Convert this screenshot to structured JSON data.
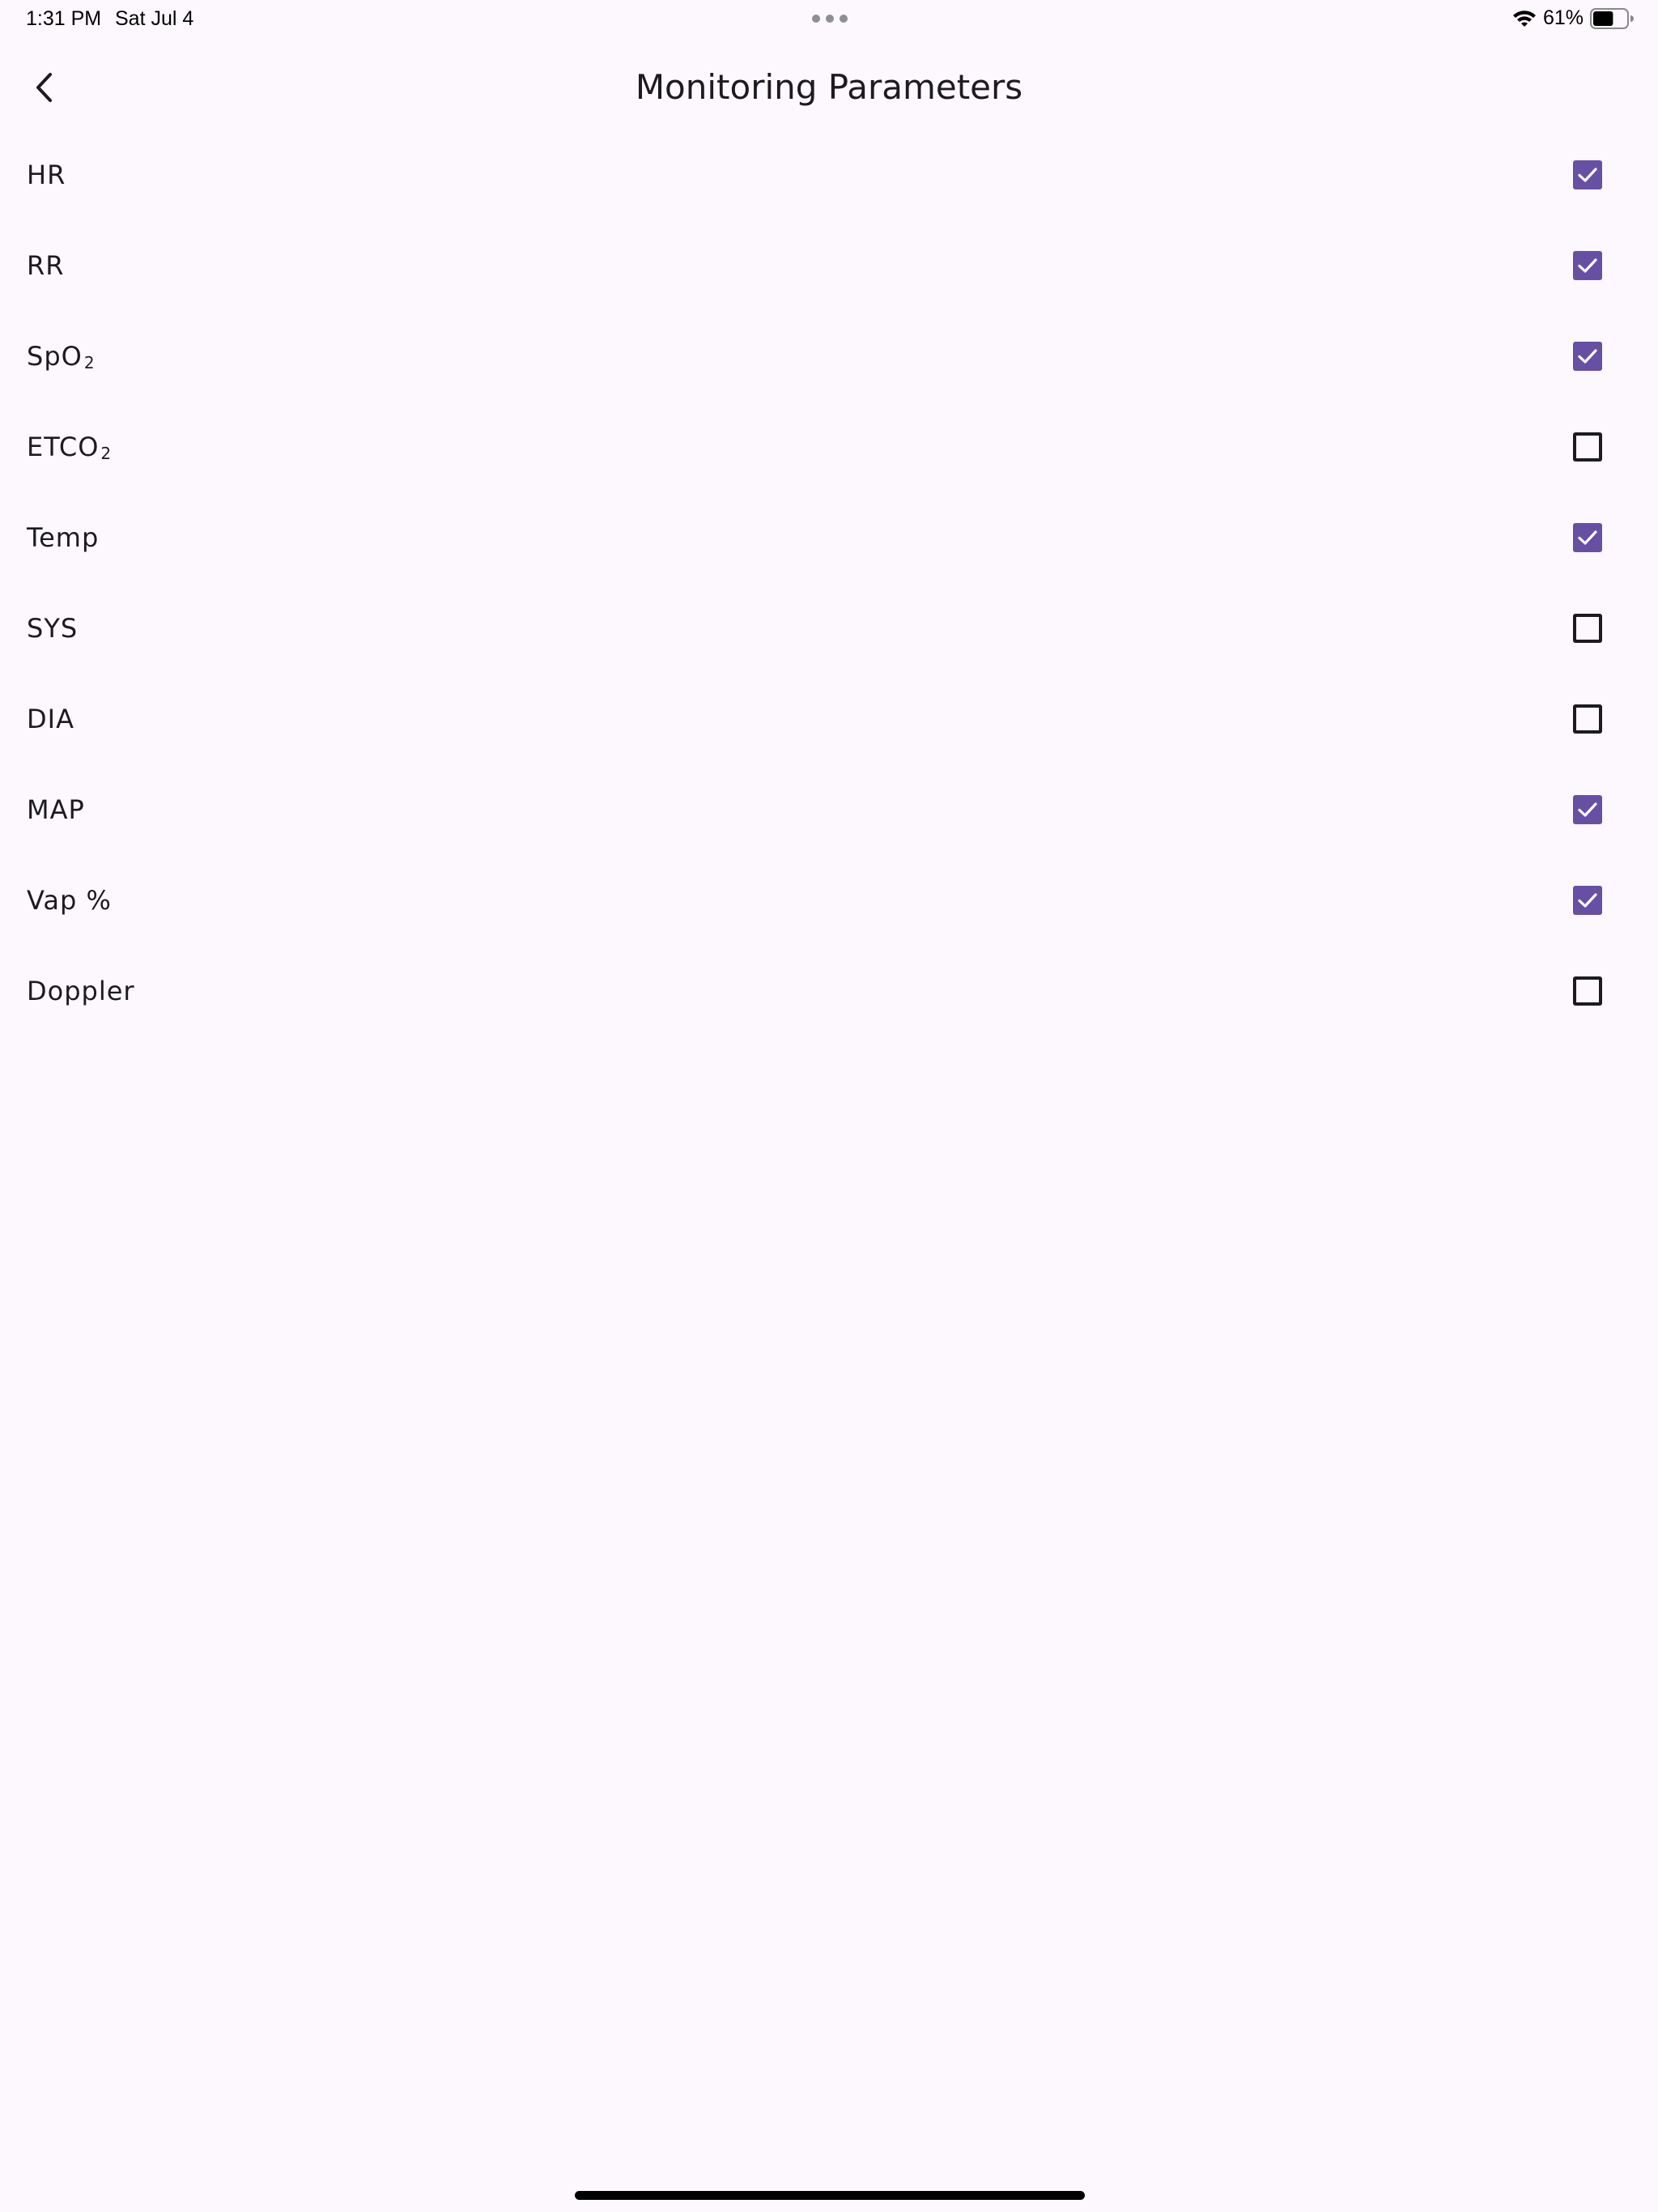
{
  "status_bar": {
    "time": "1:31 PM",
    "date": "Sat Jul 4",
    "battery_percent": "61%",
    "battery_level": 0.61,
    "icons": [
      "wifi-icon",
      "battery-icon"
    ]
  },
  "header": {
    "title": "Monitoring Parameters",
    "back_icon": "chevron-left-icon"
  },
  "params": [
    {
      "label": "HR",
      "sub": "",
      "checked": true
    },
    {
      "label": "RR",
      "sub": "",
      "checked": true
    },
    {
      "label": "SpO",
      "sub": "2",
      "checked": true
    },
    {
      "label": "ETCO",
      "sub": "2",
      "checked": false
    },
    {
      "label": "Temp",
      "sub": "",
      "checked": true
    },
    {
      "label": "SYS",
      "sub": "",
      "checked": false
    },
    {
      "label": "DIA",
      "sub": "",
      "checked": false
    },
    {
      "label": "MAP",
      "sub": "",
      "checked": true
    },
    {
      "label": "Vap %",
      "sub": "",
      "checked": true
    },
    {
      "label": "Doppler",
      "sub": "",
      "checked": false
    }
  ],
  "colors": {
    "background": "#fdf8fd",
    "checkbox_checked": "#6750a4",
    "text": "#1d1b20"
  }
}
